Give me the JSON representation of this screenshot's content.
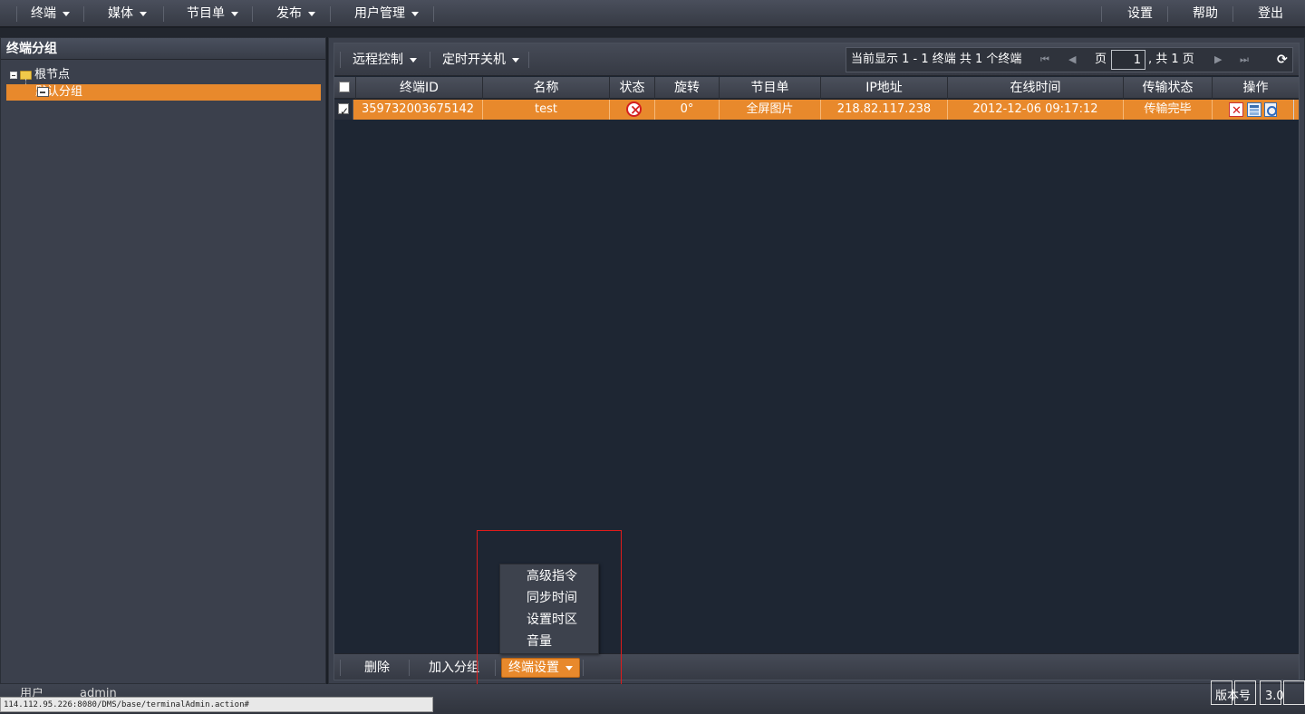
{
  "top_menu": {
    "left_items": [
      {
        "label": "终端"
      },
      {
        "label": "媒体"
      },
      {
        "label": "节目单"
      },
      {
        "label": "发布"
      },
      {
        "label": "用户管理"
      }
    ],
    "right_items": [
      {
        "label": "设置"
      },
      {
        "label": "帮助"
      },
      {
        "label": "登出"
      }
    ]
  },
  "left_panel": {
    "title": "终端分组",
    "tree": {
      "root_label": "根节点",
      "children": [
        {
          "label": "默认分组",
          "selected": true
        }
      ]
    }
  },
  "toolbar": {
    "remote_control_label": "远程控制",
    "scheduled_power_label": "定时开关机"
  },
  "pager": {
    "summary": "当前显示 1 - 1 终端 共 1 个终端",
    "page_label": "页",
    "page_value": "1",
    "total_label": ", 共 1 页"
  },
  "table": {
    "columns": [
      "终端ID",
      "名称",
      "状态",
      "旋转",
      "节目单",
      "IP地址",
      "在线时间",
      "传输状态",
      "操作"
    ],
    "rows": [
      {
        "checked": true,
        "terminal_id": "359732003675142",
        "name": "test",
        "status": "offline",
        "rotation": "0°",
        "playlist": "全屏图片",
        "ip": "218.82.117.238",
        "online_time": "2012-12-06 09:17:12",
        "transfer_status": "传输完毕"
      }
    ]
  },
  "bottom_bar": {
    "delete_label": "删除",
    "add_group_label": "加入分组",
    "terminal_settings_label": "终端设置"
  },
  "dropdown": {
    "items": [
      {
        "label": "高级指令"
      },
      {
        "label": "同步时间"
      },
      {
        "label": "设置时区"
      },
      {
        "label": "音量"
      }
    ]
  },
  "status_bar": {
    "url": "114.112.95.226:8080/DMS/base/terminalAdmin.action#",
    "user_label": "用户",
    "user_value": "admin",
    "version_label": "版本号",
    "version_value": "3.0"
  },
  "colors": {
    "accent": "#e8892c",
    "background": "#1e2633",
    "panel": "#3b404c",
    "highlight_border": "#e01b1b"
  }
}
